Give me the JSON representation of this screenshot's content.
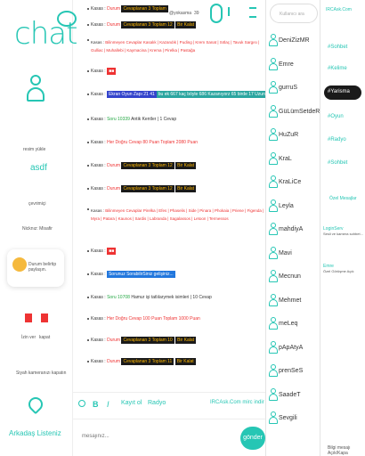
{
  "app": {
    "logo": "chat"
  },
  "left": {
    "status_label": "resim yükle",
    "username": "asdf",
    "status_select": "çevrimiçi",
    "nick": "Nicknız: Misafir",
    "mood_text": "Durum belirtip paylaşın.",
    "cam_on": "İzin ver",
    "cam_off": "kapat",
    "cam_note": "Siyah kameranızı kapatın",
    "friends_title": "Arkadaş Listeniz"
  },
  "topbar": {
    "user": "@yokasma",
    "count": "39"
  },
  "messages": [
    {
      "who": "Kasas :",
      "nick": "Durum",
      "text": "Cevaplanan 3 Toplam",
      "extra": ""
    },
    {
      "who": "Kasas :",
      "nick": "Durum",
      "text": "Cevaplanan 3 Toplam 12",
      "extra": "Bir Kalat"
    },
    {
      "who": "Kasas :",
      "nick": "Bilinmeyen Cevaplar",
      "text": "Kasalık | Kazandık | Puding | Krem Sanat | Sıtlaç | Tavuk Sargısı | Gulliac | Muhallebi | Kaymacina | Krema | Pirelka | Pastağa",
      "extra": ""
    },
    {
      "who": "Kasas :",
      "nick": "",
      "text": "",
      "extra": ""
    },
    {
      "who": "Kasas :",
      "nick": "Ekran Oyun Zapı 21 41",
      "text": "bu ek 667 kaç böyle 686 Kazanıyorz 65 birde 17 Uzun",
      "extra": ""
    },
    {
      "who": "Kasas :",
      "nick": "Soru 10339",
      "text": "Antik Kentler | 1 Cevap",
      "extra": ""
    },
    {
      "who": "Kasas :",
      "nick": "Her Doğru Cevap 80",
      "text": "Puan Toplam 2080 Puan",
      "extra": ""
    },
    {
      "who": "Kasas :",
      "nick": "Durum",
      "text": "Cevaplanan 3 Toplam 12",
      "extra": "Bir Kalat"
    },
    {
      "who": "Kasas :",
      "nick": "Durum",
      "text": "Cevaplanan 3 Toplam 12",
      "extra": "Bir Kalat"
    },
    {
      "who": "Kasas :",
      "nick": "Bilinmeyen Cevaplar",
      "text": "Pirelka | Efes | Phaselis | Side | Pinara | Phokaia | Priene | Figenda | Myra | Patara | Kaunos | Sardis | Labranda | Sagalassos | Letoon | Termessos",
      "extra": ""
    },
    {
      "who": "Kasas :",
      "nick": "",
      "text": "",
      "extra": ""
    },
    {
      "who": "Kasas :",
      "nick": "Sorunuz SorabilirSiniz gelişiniz...",
      "text": "",
      "extra": ""
    },
    {
      "who": "Kasas :",
      "nick": "Soru 10708",
      "text": "Hamur işi tatlılarymek isimleri | 10 Cevap",
      "extra": ""
    },
    {
      "who": "Kasas :",
      "nick": "Her Doğru Cevap 100",
      "text": "Puan Toplam 1000 Puan",
      "extra": ""
    },
    {
      "who": "Kasas :",
      "nick": "Durum",
      "text": "Cevaplanan 3 Toplam 10",
      "extra": "Bir Kalat"
    },
    {
      "who": "Kasas :",
      "nick": "Durum",
      "text": "Cevaplanan 3 Toplam 11",
      "extra": "Bir Kalat"
    }
  ],
  "toolbar": {
    "bold": "B",
    "italic": "I",
    "kayit": "Kayıt ol",
    "radio": "Radyo",
    "status": "IRCAsk.Com mirc indir"
  },
  "input": {
    "placeholder": "mesajınız...",
    "send": "gönder"
  },
  "users": {
    "search_placeholder": "Kullanıcı ara",
    "list": [
      "DeniZizMR",
      "Emre",
      "gurruS",
      "GüLümSetdeRie",
      "HuZuR",
      "KraL",
      "KraLiCe",
      "Leyla",
      "mahdiyA",
      "Mavi",
      "Mecnun",
      "Mehmet",
      "meLeq",
      "pApAtyA",
      "prenSeS",
      "SaadeT",
      "Sevgili"
    ]
  },
  "rooms": {
    "title": "IRCAsk.Com",
    "list": [
      "#Sohbet",
      "#Kelime",
      "#Yarisma",
      "#Oyun",
      "#Radyo",
      "#Sohbet"
    ],
    "private_label": "Özel Mesajlar",
    "notes": [
      {
        "name": "LoginServ",
        "text": "Sesli ve kamera sohbet..."
      },
      {
        "name": "Emre",
        "text": "Özel Görüşme Açık"
      }
    ],
    "footer": "Bilgi mesajı Açık/Kapa"
  }
}
